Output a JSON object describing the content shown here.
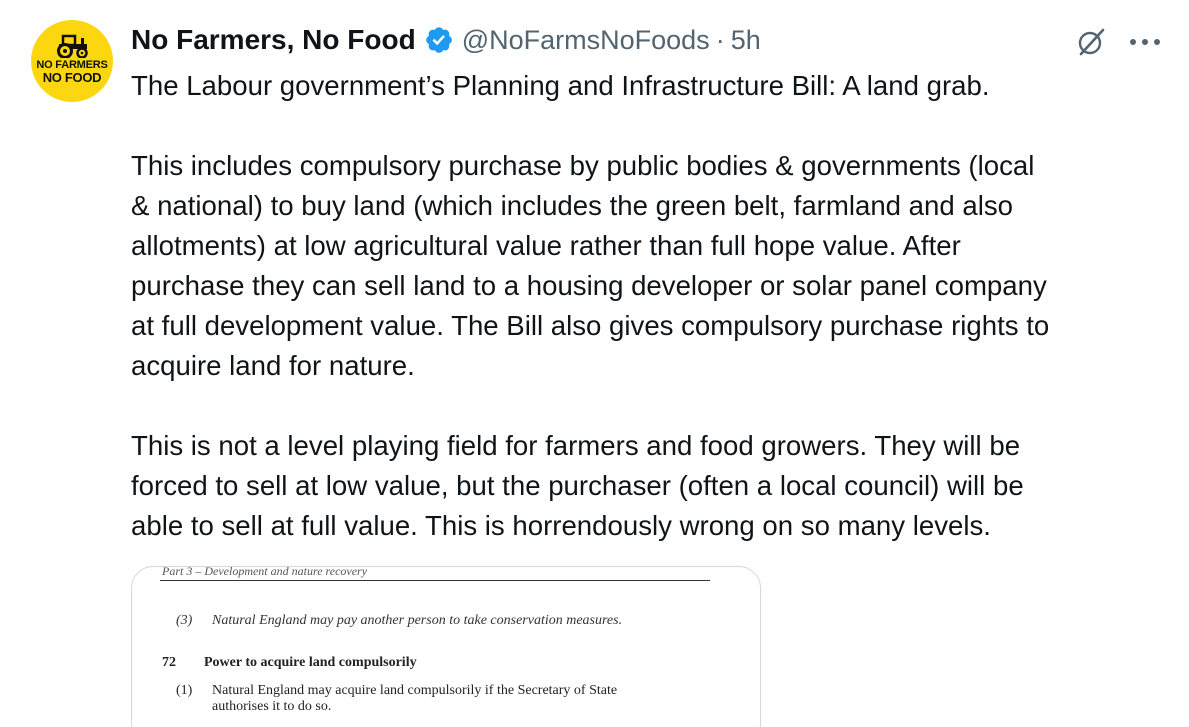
{
  "account": {
    "display_name": "No Farmers, No Food",
    "handle": "@NoFarmsNoFoods",
    "separator": "·",
    "time": "5h",
    "avatar_logo_line1": "NO FARMERS",
    "avatar_logo_line2": "NO FOOD",
    "verified_color": "#1d9bf0",
    "avatar_color": "#fcd60f"
  },
  "actions": {
    "grok_icon": "grok-icon",
    "more_icon": "more-icon"
  },
  "tweet": {
    "paragraphs": [
      "The Labour government’s Planning and Infrastructure Bill: A land grab.",
      "This includes compulsory purchase by public bodies & governments (local\n& national) to buy land (which includes the green belt, farmland and also\nallotments) at low agricultural value rather than full hope value. After\npurchase they can sell land to a housing developer or solar panel company\nat full development value. The Bill also gives compulsory purchase rights to\nacquire land for nature.",
      "This is not a level playing field for farmers and food growers. They will be\nforced to sell at low value, but the purchaser (often a local council) will be\nable to sell at full value. This is horrendously wrong on so many levels."
    ]
  },
  "media": {
    "running_header": "Part 3 – Development and nature recovery",
    "clause3_num": "(3)",
    "clause3_text": "Natural England may pay another person to take conservation measures.",
    "section_num": "72",
    "section_title": "Power to acquire land compulsorily",
    "clause1_num": "(1)",
    "clause1_line1": "Natural England may acquire land compulsorily if the Secretary of State",
    "clause1_line2": "authorises it to do so."
  }
}
